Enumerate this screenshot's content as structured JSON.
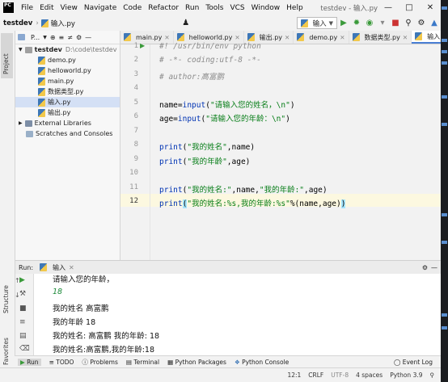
{
  "menu": {
    "items": [
      "File",
      "Edit",
      "View",
      "Navigate",
      "Code",
      "Refactor",
      "Run",
      "Tools",
      "VCS",
      "Window",
      "Help"
    ],
    "window_title": "testdev - 输入.py"
  },
  "nav": {
    "project": "testdev",
    "file": "输入.py",
    "run_config": "输入"
  },
  "project_panel": {
    "title": "P...",
    "tool_label": "Project",
    "root": {
      "name": "testdev",
      "path": "D:\\code\\testdev"
    },
    "files": [
      "demo.py",
      "helloworld.py",
      "main.py",
      "数据类型.py",
      "输入.py",
      "输出.py"
    ],
    "external": "External Libraries",
    "scratches": "Scratches and Consoles"
  },
  "editor": {
    "tabs": [
      "main.py",
      "helloworld.py",
      "输出.py",
      "demo.py",
      "数据类型.py",
      "输入.py"
    ],
    "active_tab": "输入.py",
    "line_numbers": [
      "1",
      "2",
      "3",
      "4",
      "5",
      "6",
      "7",
      "8",
      "9",
      "10",
      "11",
      "12"
    ],
    "lines": {
      "l1": "#! /usr/bin/env python",
      "l2": "# -*- coding:utf-8 -*-",
      "l3": "# author:高富鹏",
      "l5a": "name=",
      "l5b": "input",
      "l5c": "(",
      "l5d": "\"请输入您的姓名，\\n\"",
      "l5e": ")",
      "l6a": "age=",
      "l6b": "input",
      "l6c": "(",
      "l6d": "\"请输入您的年龄：\\n\"",
      "l6e": ")",
      "l8a": "print",
      "l8b": "(",
      "l8c": "\"我的姓名\"",
      "l8d": ",name)",
      "l9a": "print",
      "l9b": "(",
      "l9c": "\"我的年龄\"",
      "l9d": ",age)",
      "l11a": "print",
      "l11b": "(",
      "l11c": "\"我的姓名:\"",
      "l11d": ",name,",
      "l11e": "\"我的年龄:\"",
      "l11f": ",age)",
      "l12a": "print",
      "l12b": "(",
      "l12c": "\"我的姓名:%s,我的年龄:%s\"",
      "l12d": "%(name,age)",
      "l12e": ")"
    }
  },
  "run": {
    "label": "Run:",
    "config": "输入",
    "output": [
      "请输入您的年龄，",
      "18",
      "我的姓名 高富鹏",
      "我的年龄 18",
      "我的姓名: 高富鹏 我的年龄: 18",
      "我的姓名:高富鹏,我的年龄:18"
    ]
  },
  "bottom_tabs": [
    "Run",
    "TODO",
    "Problems",
    "Terminal",
    "Python Packages",
    "Python Console"
  ],
  "left_strip": {
    "structure": "Structure",
    "favorites": "Favorites"
  },
  "status": {
    "event_log": "Event Log",
    "position": "12:1",
    "line_sep": "CRLF",
    "encoding": "UTF-8",
    "indent": "4 spaces",
    "interpreter": "Python 3.9"
  },
  "colors": {
    "accent": "#4a7fd4",
    "string": "#067d17",
    "function": "#0033b3",
    "comment": "#8c8c8c"
  }
}
